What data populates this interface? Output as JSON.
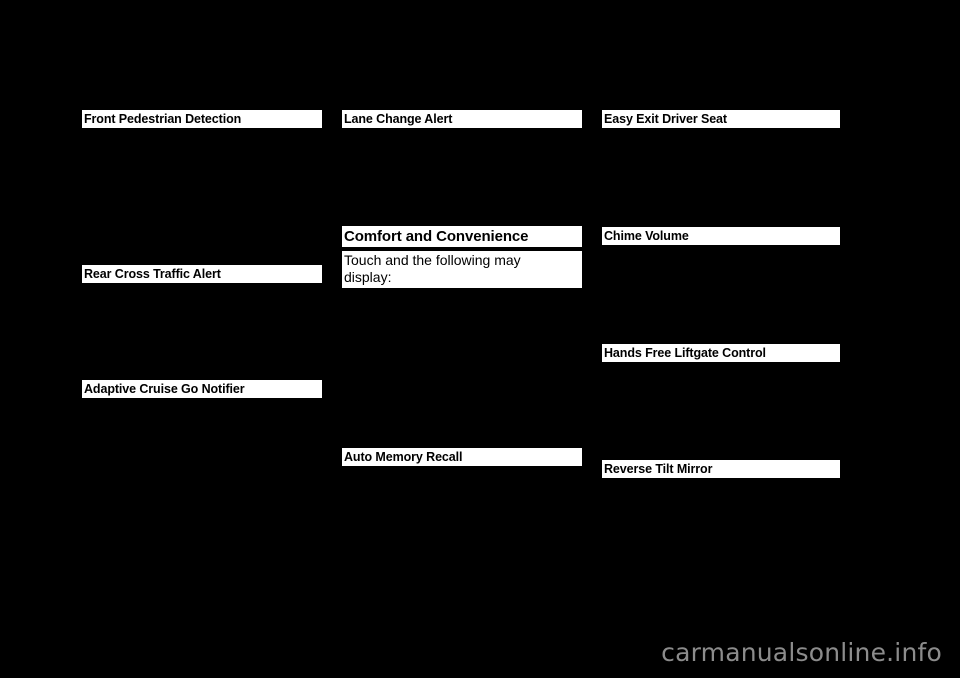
{
  "page": {
    "background_color": "#000000",
    "text_box_color": "#ffffff",
    "text_color": "#000000"
  },
  "columns": [
    {
      "id": "column-1",
      "blocks": [
        {
          "type": "heading",
          "text": "Front Pedestrian Detection"
        },
        {
          "type": "heading",
          "text": "Rear Cross Traffic Alert"
        },
        {
          "type": "heading",
          "text": "Adaptive Cruise Go Notifier"
        }
      ]
    },
    {
      "id": "column-2",
      "blocks": [
        {
          "type": "heading",
          "text": "Lane Change Alert"
        },
        {
          "type": "section-heading",
          "text": "Comfort and Convenience"
        },
        {
          "type": "body",
          "line1": "Touch and the following may",
          "line2": "display:"
        },
        {
          "type": "heading",
          "text": "Auto Memory Recall"
        }
      ]
    },
    {
      "id": "column-3",
      "blocks": [
        {
          "type": "heading",
          "text": "Easy Exit Driver Seat"
        },
        {
          "type": "heading",
          "text": "Chime Volume"
        },
        {
          "type": "heading",
          "text": "Hands Free Liftgate Control"
        },
        {
          "type": "heading",
          "text": "Reverse Tilt Mirror"
        }
      ]
    }
  ],
  "watermark": {
    "text": "carmanualsonline.info",
    "color": "#8c8c8c"
  }
}
